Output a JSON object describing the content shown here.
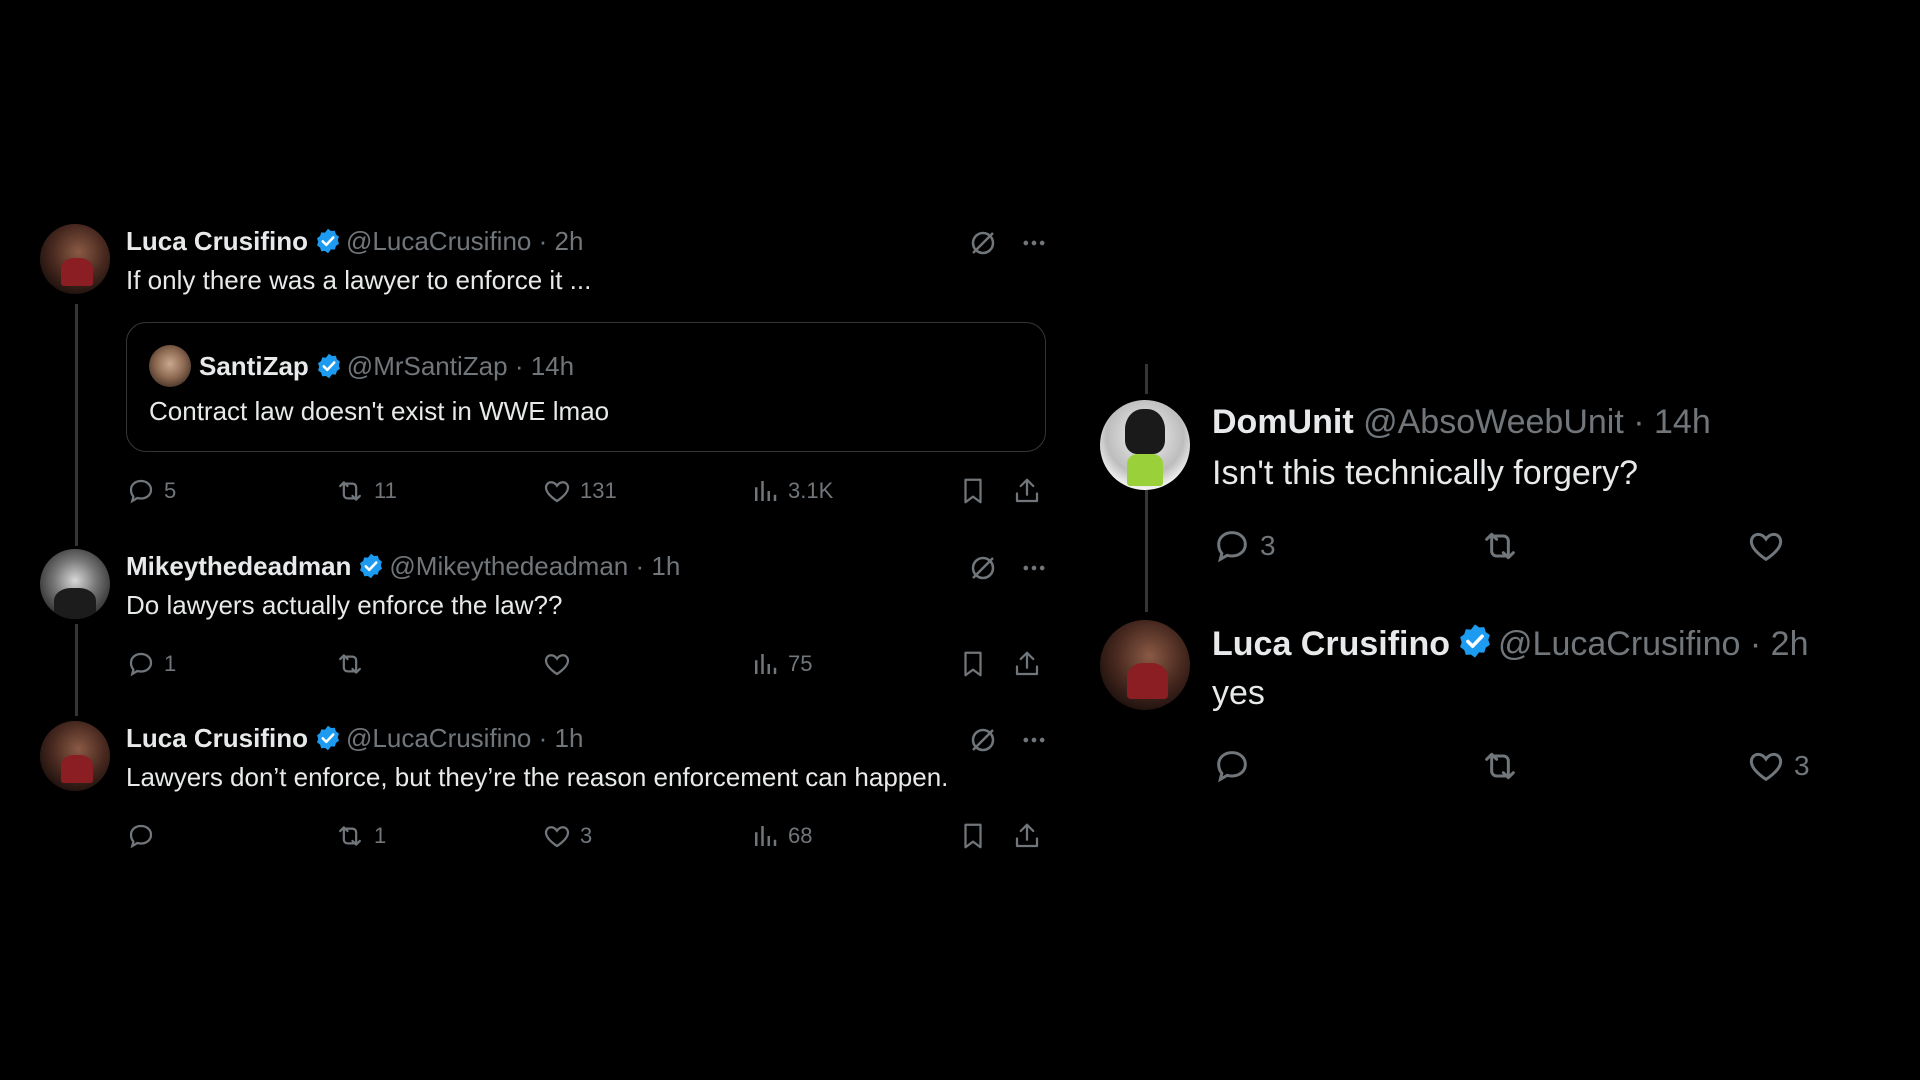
{
  "left_thread": {
    "tweets": [
      {
        "name": "Luca Crusifino",
        "handle": "@LucaCrusifino",
        "time": "· 2h",
        "text": "If only there was a lawyer to enforce it ...",
        "quote": {
          "name": "SantiZap",
          "handle": "@MrSantiZap",
          "time": "· 14h",
          "text": "Contract law doesn't exist in WWE lmao"
        },
        "replies": "5",
        "reposts": "11",
        "likes": "131",
        "views": "3.1K"
      },
      {
        "name": "Mikeythedeadman",
        "handle": "@Mikeythedeadman",
        "time": "· 1h",
        "text": "Do lawyers actually enforce the law??",
        "replies": "1",
        "reposts": "",
        "likes": "",
        "views": "75"
      },
      {
        "name": "Luca Crusifino",
        "handle": "@LucaCrusifino",
        "time": "· 1h",
        "text": "Lawyers don’t enforce, but they’re the reason enforcement can happen.",
        "replies": "",
        "reposts": "1",
        "likes": "3",
        "views": "68"
      }
    ]
  },
  "right_thread": {
    "tweets": [
      {
        "name": "DomUnit",
        "handle": "@AbsoWeebUnit",
        "time": "· 14h",
        "text": "Isn't this technically forgery?",
        "replies": "3",
        "reposts": "",
        "likes": ""
      },
      {
        "name": "Luca Crusifino",
        "handle": "@LucaCrusifino",
        "time": "· 2h",
        "text": "yes",
        "replies": "",
        "reposts": "",
        "likes": "3"
      }
    ]
  },
  "colors": {
    "background": "#000000",
    "text": "#e7e9ea",
    "muted": "#71767b",
    "verified": "#1d9bf0",
    "border": "#333639"
  },
  "icons": [
    "verified-badge-icon",
    "grok-icon",
    "more-icon",
    "reply-icon",
    "repost-icon",
    "like-icon",
    "views-icon",
    "bookmark-icon",
    "share-icon"
  ]
}
